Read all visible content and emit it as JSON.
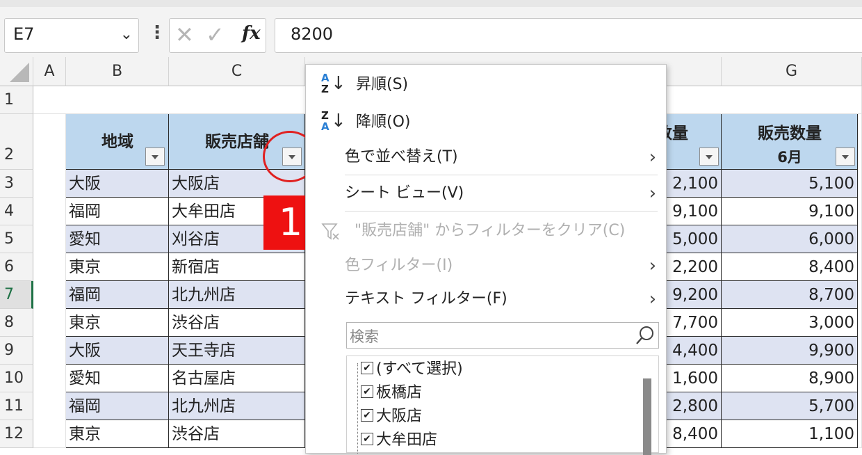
{
  "formula_bar": {
    "name_box": "E7",
    "cancel_glyph": "✕",
    "enter_glyph": "✓",
    "fx_label": "fx",
    "formula_value": "8200"
  },
  "columns": {
    "A": "A",
    "B": "B",
    "C": "C",
    "F": "",
    "G": "G"
  },
  "rows": [
    "1",
    "2",
    "3",
    "4",
    "5",
    "6",
    "7",
    "8",
    "9",
    "10",
    "11",
    "12"
  ],
  "selected_row": "7",
  "table": {
    "header_region": "地域",
    "header_store": "販売店舗",
    "header_f_partial": "数量",
    "header_g_line1": "販売数量",
    "header_g_line2": "6月",
    "data": [
      {
        "region": "大阪",
        "store": "大阪店",
        "f": "2,100",
        "g": "5,100"
      },
      {
        "region": "福岡",
        "store": "大牟田店",
        "f": "9,100",
        "g": "9,100"
      },
      {
        "region": "愛知",
        "store": "刈谷店",
        "f": "5,000",
        "g": "6,000"
      },
      {
        "region": "東京",
        "store": "新宿店",
        "f": "2,200",
        "g": "8,400"
      },
      {
        "region": "福岡",
        "store": "北九州店",
        "f": "9,200",
        "g": "8,700"
      },
      {
        "region": "東京",
        "store": "渋谷店",
        "f": "7,700",
        "g": "3,000"
      },
      {
        "region": "大阪",
        "store": "天王寺店",
        "f": "4,400",
        "g": "9,900"
      },
      {
        "region": "愛知",
        "store": "名古屋店",
        "f": "1,600",
        "g": "8,900"
      },
      {
        "region": "福岡",
        "store": "北九州店",
        "f": "2,800",
        "g": "5,700"
      },
      {
        "region": "東京",
        "store": "渋谷店",
        "f": "8,400",
        "g": "1,100"
      }
    ]
  },
  "annotation": {
    "step_number": "1"
  },
  "menu": {
    "sort_asc": "昇順(S)",
    "sort_desc": "降順(O)",
    "sort_by_color": "色で並べ替え(T)",
    "sheet_view": "シート ビュー(V)",
    "clear_filter": "\"販売店舗\" からフィルターをクリア(C)",
    "color_filter": "色フィルター(I)",
    "text_filter": "テキスト フィルター(F)",
    "search_placeholder": "検索",
    "list_items": [
      "(すべて選択)",
      "板橋店",
      "大阪店",
      "大牟田店"
    ],
    "chevron": "›",
    "colors": {
      "accent_red": "#ee1111",
      "header_blue": "#bdd7ee",
      "band_blue": "#dee3f2"
    }
  }
}
